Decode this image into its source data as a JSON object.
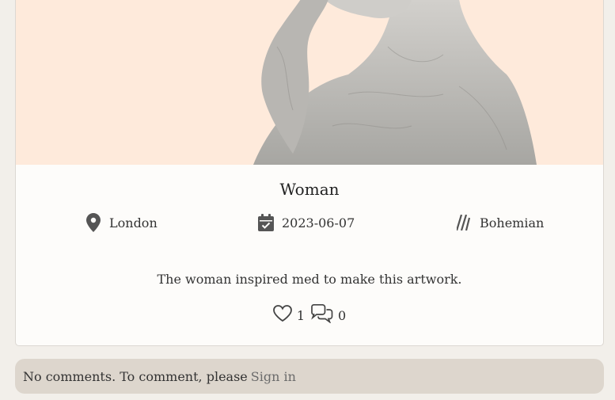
{
  "post": {
    "title": "Woman",
    "location": "London",
    "date": "2023-06-07",
    "style": "Bohemian",
    "description": "The woman inspired med to make this artwork.",
    "likes": "1",
    "comments": "0"
  },
  "comments_section": {
    "message": "No comments. To comment, please",
    "signin_label": "Sign in"
  },
  "icons": {
    "location": "map-pin-icon",
    "date": "calendar-check-icon",
    "style": "brush-strokes-icon",
    "likes": "heart-icon",
    "comments": "chat-bubbles-icon"
  },
  "colors": {
    "page_bg": "#f2efea",
    "card_bg": "#fdfcfa",
    "artwork_bg": "#feeadb",
    "comments_bar_bg": "#ddd6cd",
    "icon_color": "#555555"
  }
}
